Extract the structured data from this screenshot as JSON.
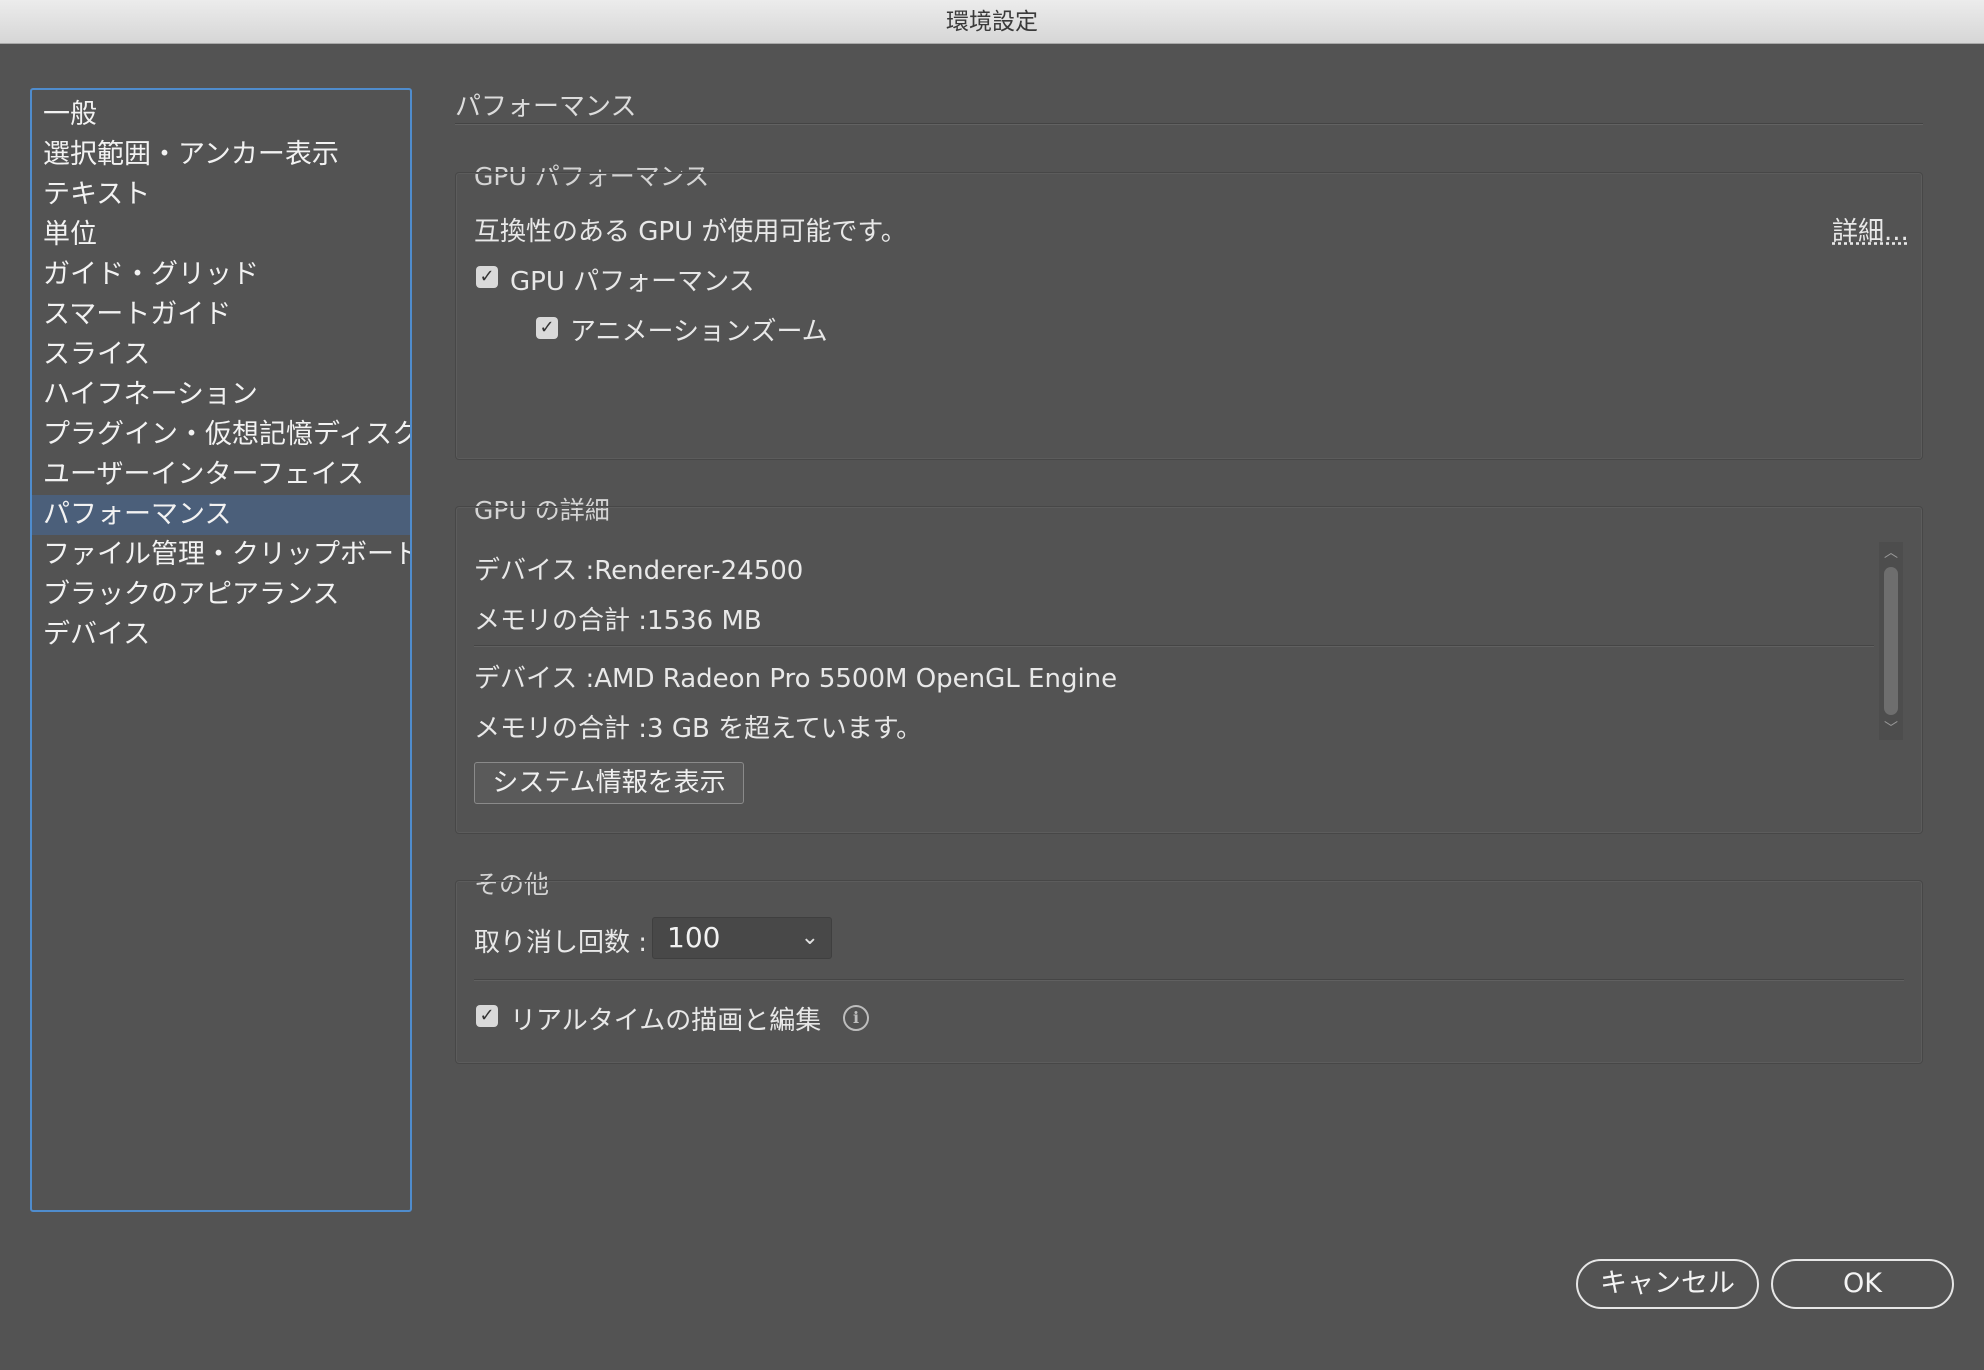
{
  "window": {
    "title": "環境設定"
  },
  "sidebar": {
    "items": [
      {
        "label": "一般"
      },
      {
        "label": "選択範囲・アンカー表示"
      },
      {
        "label": "テキスト"
      },
      {
        "label": "単位"
      },
      {
        "label": "ガイド・グリッド"
      },
      {
        "label": "スマートガイド"
      },
      {
        "label": "スライス"
      },
      {
        "label": "ハイフネーション"
      },
      {
        "label": "プラグイン・仮想記憶ディスク"
      },
      {
        "label": "ユーザーインターフェイス"
      },
      {
        "label": "パフォーマンス",
        "selected": true
      },
      {
        "label": "ファイル管理・クリップボード"
      },
      {
        "label": "ブラックのアピアランス"
      },
      {
        "label": "デバイス"
      }
    ]
  },
  "page": {
    "title": "パフォーマンス"
  },
  "gpu_performance": {
    "group_label": "GPU パフォーマンス",
    "status_text": "互換性のある GPU が使用可能です。",
    "details_link": "詳細...",
    "gpu_checkbox_label": "GPU パフォーマンス",
    "gpu_checked": true,
    "animation_zoom_label": "アニメーションズーム",
    "animation_zoom_checked": true
  },
  "gpu_details": {
    "group_label": "GPU の詳細",
    "devices": [
      {
        "device": "デバイス :Renderer-24500",
        "memory": "メモリの合計 :1536 MB"
      },
      {
        "device": "デバイス :AMD Radeon Pro 5500M OpenGL Engine",
        "memory": "メモリの合計 :3 GB を超えています。"
      }
    ],
    "system_info_button": "システム情報を表示"
  },
  "other": {
    "group_label": "その他",
    "undo_label": "取り消し回数 :",
    "undo_value": "100",
    "realtime_label": "リアルタイムの描画と編集",
    "realtime_checked": true,
    "info_icon": "i"
  },
  "footer": {
    "cancel_label": "キャンセル",
    "ok_label": "OK"
  },
  "colors": {
    "background": "#535353",
    "sidebar_border": "#4f8ccd",
    "selected_item": "#4b5f7a"
  }
}
